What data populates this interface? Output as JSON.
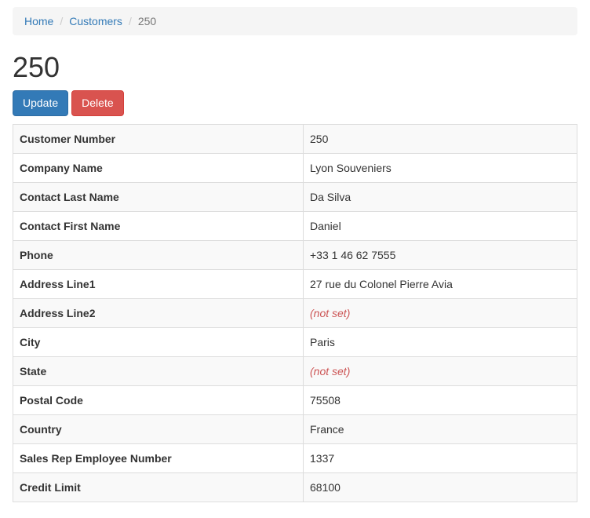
{
  "breadcrumb": {
    "home": "Home",
    "customers": "Customers",
    "current": "250",
    "separator": "/"
  },
  "page_title": "250",
  "actions": {
    "update_label": "Update",
    "delete_label": "Delete"
  },
  "details": [
    {
      "label": "Customer Number",
      "value": "250",
      "not_set": false
    },
    {
      "label": "Company Name",
      "value": "Lyon Souveniers",
      "not_set": false
    },
    {
      "label": "Contact Last Name",
      "value": "Da Silva",
      "not_set": false
    },
    {
      "label": "Contact First Name",
      "value": "Daniel",
      "not_set": false
    },
    {
      "label": "Phone",
      "value": "+33 1 46 62 7555",
      "not_set": false
    },
    {
      "label": "Address Line1",
      "value": "27 rue du Colonel Pierre Avia",
      "not_set": false
    },
    {
      "label": "Address Line2",
      "value": "(not set)",
      "not_set": true
    },
    {
      "label": "City",
      "value": "Paris",
      "not_set": false
    },
    {
      "label": "State",
      "value": "(not set)",
      "not_set": true
    },
    {
      "label": "Postal Code",
      "value": "75508",
      "not_set": false
    },
    {
      "label": "Country",
      "value": "France",
      "not_set": false
    },
    {
      "label": "Sales Rep Employee Number",
      "value": "1337",
      "not_set": false
    },
    {
      "label": "Credit Limit",
      "value": "68100",
      "not_set": false
    }
  ],
  "colors": {
    "link": "#337ab7",
    "primary_button": "#337ab7",
    "danger_button": "#d9534f",
    "not_set_text": "#cc5555"
  }
}
